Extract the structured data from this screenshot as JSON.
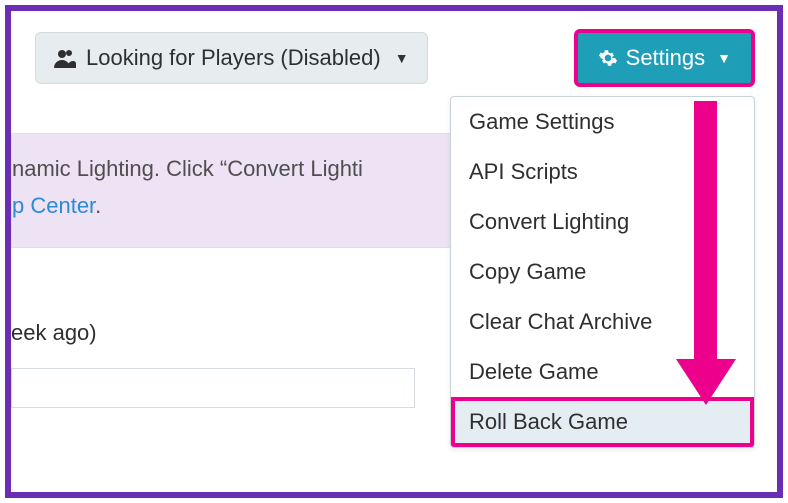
{
  "top": {
    "lfp_label": "Looking for Players (Disabled)",
    "settings_label": "Settings"
  },
  "dropdown": {
    "items": [
      {
        "label": "Game Settings"
      },
      {
        "label": "API Scripts"
      },
      {
        "label": "Convert Lighting"
      },
      {
        "label": "Copy Game"
      },
      {
        "label": "Clear Chat Archive"
      },
      {
        "label": "Delete Game"
      },
      {
        "label": "Roll Back Game"
      }
    ]
  },
  "banner": {
    "text_fragment": "namic Lighting. Click “Convert Lighti",
    "link_fragment": "p Center",
    "period": "."
  },
  "last_played_fragment": "eek ago)"
}
